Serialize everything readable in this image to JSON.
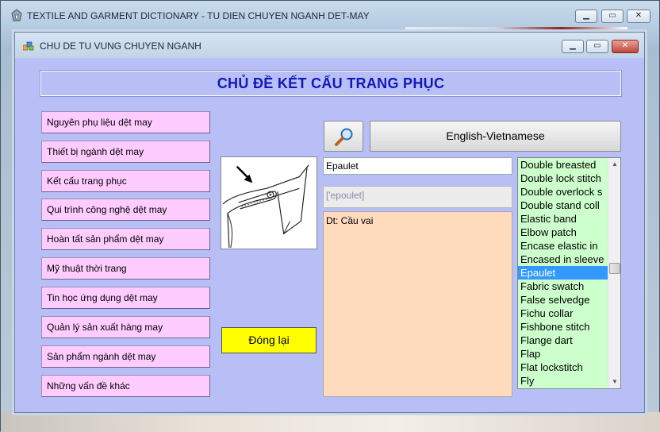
{
  "app": {
    "title": "TEXTILE AND GARMENT DICTIONARY - TU DIEN CHUYEN NGANH DET-MAY",
    "icon": "app-icon",
    "caption_buttons": [
      "minimize",
      "maximize",
      "close"
    ]
  },
  "child_window": {
    "title": "CHU DE TU VUNG CHUYEN NGANH",
    "icon": "form-icon"
  },
  "header": {
    "title": "CHỦ ĐỀ KẾT CẤU TRANG PHỤC",
    "color": "#1019b8"
  },
  "topics": [
    {
      "label": "Nguyên phụ liệu dệt may"
    },
    {
      "label": "Thiết bị ngành dệt may"
    },
    {
      "label": "Kết cấu trang phục"
    },
    {
      "label": "Qui trình công nghệ dệt may"
    },
    {
      "label": "Hoàn tất sản phẩm dệt may"
    },
    {
      "label": "Mỹ thuật thời trang"
    },
    {
      "label": "Tin học ứng dụng dệt may"
    },
    {
      "label": "Quản lý sản xuất hàng may"
    },
    {
      "label": "Sản phẩm ngành dệt may"
    },
    {
      "label": "Những vấn đề khác"
    }
  ],
  "close_button": {
    "label": "Đóng lại",
    "color": "#ffff00"
  },
  "search": {
    "icon": "magnifier-icon"
  },
  "language_button": {
    "label": "English-Vietnamese"
  },
  "entry": {
    "word": "Epaulet",
    "phonetic": "['epoulet]",
    "meaning": "Dt: Cầu vai"
  },
  "word_list": {
    "items": [
      "Double breasted",
      "Double lock stitch",
      "Double overlock s",
      "Double stand coll",
      "Elastic band",
      "Elbow patch",
      "Encase elastic in",
      "Encased in sleeve",
      "Epaulet",
      "Fabric swatch",
      "False selvedge",
      "Fichu collar",
      "Fishbone stitch",
      "Flange dart",
      "Flap",
      "Flat lockstitch",
      "Fly"
    ],
    "selected": "Epaulet",
    "selected_color": "#3399ff",
    "background": "#ccffcc"
  },
  "colors": {
    "form_background": "#b7bff6",
    "topic_button": "#ffccff",
    "meaning_background": "#ffdbbd"
  }
}
